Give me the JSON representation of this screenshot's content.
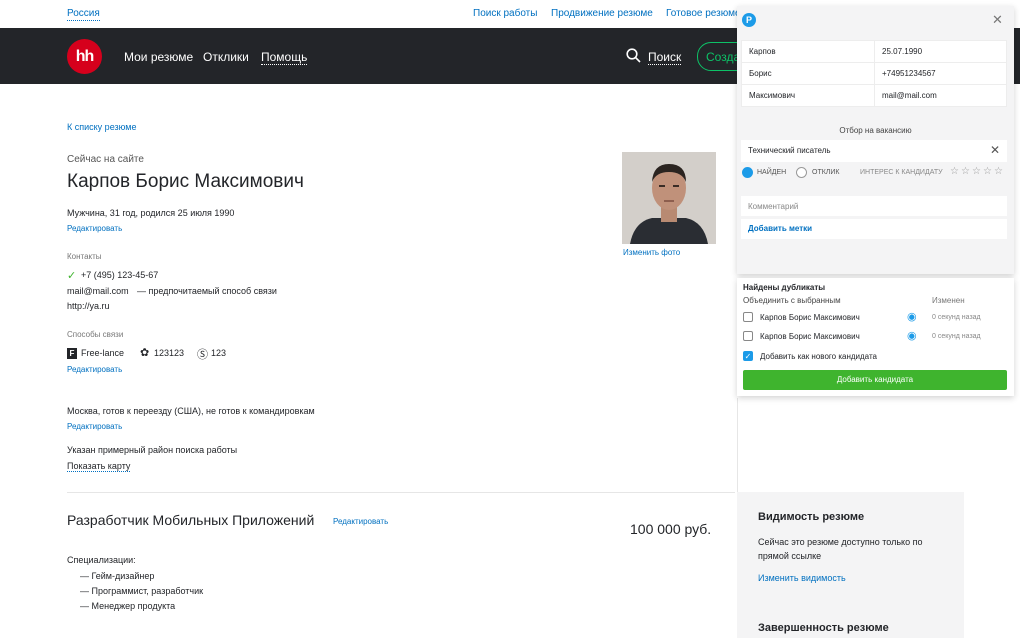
{
  "topbar": {
    "region": "Россия",
    "links": [
      "Поиск работы",
      "Продвижение резюме",
      "Готовое резюме"
    ]
  },
  "header": {
    "logo": "hh",
    "nav": [
      "Мои резюме",
      "Отклики",
      "Помощь"
    ],
    "search_label": "Поиск",
    "create_label": "Создать"
  },
  "resume": {
    "back_link": "К списку резюме",
    "status": "Сейчас на сайте",
    "name": "Карпов Борис Максимович",
    "personal": "Мужчина, 31 год, родился 25 июля 1990",
    "edit": "Редактировать",
    "contacts_label": "Контакты",
    "phone": "+7 (495) 123-45-67",
    "email": "mail@mail.com",
    "email_note": "— предпочитаемый способ связи",
    "site": "http://ya.ru",
    "messengers_label": "Способы связи",
    "messengers": [
      {
        "icon": "freelance-icon",
        "label": "Free-lance"
      },
      {
        "icon": "icq-icon",
        "label": "123123"
      },
      {
        "icon": "skype-icon",
        "label": "123"
      }
    ],
    "location": "Москва, готов к переезду (США), не готов к командировкам",
    "area_note": "Указан примерный район поиска работы",
    "show_map": "Показать карту",
    "change_photo": "Изменить фото",
    "position": "Разработчик Мобильных Приложений",
    "salary": "100 000 руб.",
    "specs_label": "Специализации:",
    "specs": [
      "— Гейм-дизайнер",
      "— Программист, разработчик",
      "— Менеджер продукта"
    ]
  },
  "sidebar": {
    "visibility_title": "Видимость резюме",
    "visibility_text": "Сейчас это резюме доступно только по прямой ссылке",
    "change_visibility": "Изменить видимость",
    "completeness_title": "Завершенность резюме"
  },
  "popup": {
    "fields": [
      [
        "Карпов",
        "25.07.1990"
      ],
      [
        "Борис",
        "+74951234567"
      ],
      [
        "Максимович",
        "mail@mail.com"
      ]
    ],
    "section": "Отбор на вакансию",
    "vacancy": "Технический писатель",
    "radio_found": "НАЙДЕН",
    "radio_response": "ОТКЛИК",
    "interest_label": "ИНТЕРЕС К КАНДИДАТУ",
    "comment_placeholder": "Комментарий",
    "add_tags": "Добавить метки"
  },
  "duplicates": {
    "title": "Найдены дубликаты",
    "merge_label": "Объединить с выбранным",
    "changed_label": "Изменен",
    "items": [
      {
        "name": "Карпов Борис Максимович",
        "time": "0 секунд назад"
      },
      {
        "name": "Карпов Борис Максимович",
        "time": "0 секунд назад"
      }
    ],
    "add_new": "Добавить как нового кандидата",
    "add_button": "Добавить кандидата"
  },
  "colors": {
    "accent": "#0070c0",
    "header": "#232529",
    "logo": "#d6001c",
    "green": "#3fb42e",
    "blue": "#1c9be8"
  }
}
